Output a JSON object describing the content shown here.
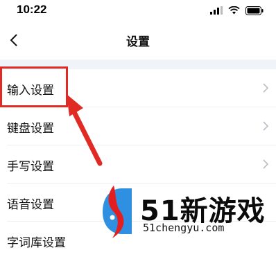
{
  "status_bar": {
    "time": "10:22"
  },
  "nav": {
    "title": "设置"
  },
  "settings": [
    {
      "label": "输入设置",
      "has_chevron": true
    },
    {
      "label": "键盘设置",
      "has_chevron": true
    },
    {
      "label": "手写设置",
      "has_chevron": true
    },
    {
      "label": "语音设置",
      "has_chevron": false
    },
    {
      "label": "字词库设置",
      "has_chevron": false
    }
  ],
  "annotation": {
    "highlight_color": "#e02a24",
    "highlighted_item": "输入设置"
  },
  "watermark": {
    "brand": "51新游戏",
    "url": "51chengyu.com"
  },
  "colors": {
    "background": "#ffffff",
    "band": "#f0f3f7",
    "chevron": "#b8bcc4"
  }
}
